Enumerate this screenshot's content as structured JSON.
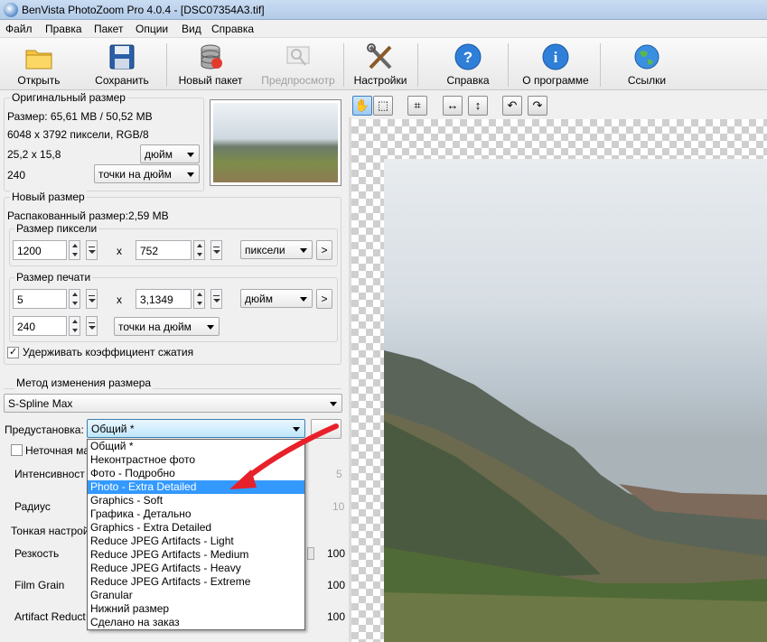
{
  "window": {
    "title": "BenVista PhotoZoom Pro 4.0.4 - [DSC07354A3.tif]"
  },
  "menu": {
    "items": [
      "Файл",
      "Правка",
      "Пакет",
      "Опции",
      "Вид",
      "Справка"
    ]
  },
  "toolbar": {
    "open": "Открыть",
    "save": "Сохранить",
    "new_batch": "Новый пакет",
    "preview": "Предпросмотр",
    "settings": "Настройки",
    "help": "Справка",
    "about": "О программе",
    "links": "Ссылки"
  },
  "original": {
    "title": "Оригинальный размер",
    "size": "Размер: 65,61 MB / 50,52 MB",
    "pixels": "6048 x 3792 пиксели, RGB/8",
    "dims": "25,2 x 15,8",
    "dims_unit": "дюйм",
    "res": "240",
    "res_unit": "точки на дюйм"
  },
  "new_size": {
    "title": "Новый размер",
    "unpacked": "Распакованный размер:2,59 MB",
    "pixel_group": "Размер пиксели",
    "width_px": "1200",
    "height_px": "752",
    "x": "x",
    "px_unit": "пиксели",
    "print_group": "Размер печати",
    "width_print": "5",
    "height_print": "3,1349",
    "print_unit": "дюйм",
    "res": "240",
    "res_unit": "точки на дюйм",
    "keep_ratio": "Удерживать коэффициент сжатия",
    "arrow_btn": ">"
  },
  "method": {
    "title": "Метод изменения размера",
    "value": "S-Spline Max",
    "preset_label": "Предустановка:",
    "preset_value": "Общий *"
  },
  "fine": {
    "unsharp_label": "Неточная ма",
    "intensity": "Интенсивност",
    "intensity_val": "5",
    "radius": "Радиус",
    "radius_val": "10",
    "fine_title": "Тонкая настрой",
    "sharpness": "Резкость",
    "sharpness_val": "100",
    "film_grain": "Film Grain",
    "film_grain_val": "100",
    "artifact": "Artifact Reduct",
    "artifact_val": "100"
  },
  "preset_options": [
    "Общий *",
    "Неконтрастное фото",
    "Фото - Подробно",
    "Photo - Extra Detailed",
    "Graphics - Soft",
    "Графика - Детально",
    "Graphics - Extra Detailed",
    "Reduce JPEG Artifacts - Light",
    "Reduce JPEG Artifacts - Medium",
    "Reduce JPEG Artifacts - Heavy",
    "Reduce JPEG Artifacts - Extreme",
    "Granular",
    "Нижний размер",
    "Сделано на заказ"
  ],
  "colors": {
    "accent": "#3399ff",
    "arrow": "#e8202a"
  }
}
